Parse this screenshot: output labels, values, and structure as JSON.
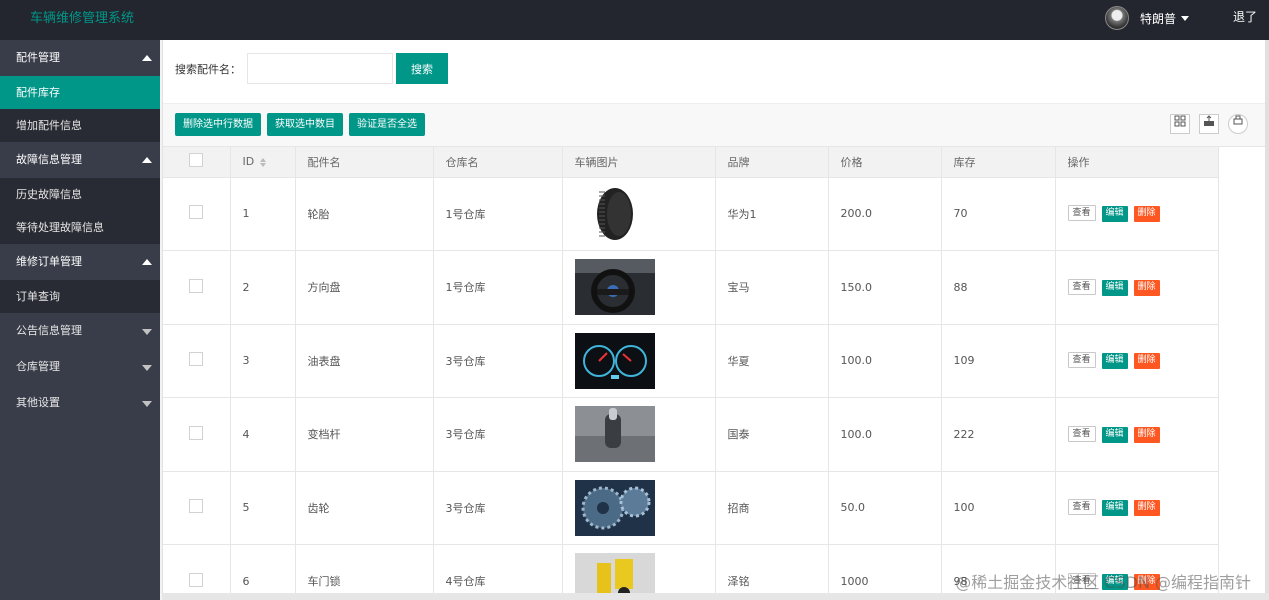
{
  "header": {
    "title": "车辆维修管理系统",
    "username": "特朗普",
    "logout": "退了"
  },
  "sidebar": {
    "groups": [
      {
        "label": "配件管理",
        "children": [
          "配件库存",
          "增加配件信息"
        ]
      },
      {
        "label": "故障信息管理",
        "children": [
          "历史故障信息",
          "等待处理故障信息"
        ]
      },
      {
        "label": "维修订单管理",
        "children": [
          "订单查询"
        ]
      },
      {
        "label": "公告信息管理",
        "children": []
      },
      {
        "label": "仓库管理",
        "children": []
      },
      {
        "label": "其他设置",
        "children": []
      }
    ]
  },
  "search": {
    "label": "搜索配件名：",
    "placeholder": "",
    "button": "搜索"
  },
  "toolbar": {
    "btn1": "删除选中行数据",
    "btn2": "获取选中数目",
    "btn3": "验证是否全选"
  },
  "table": {
    "headers": [
      "ID",
      "配件名",
      "仓库名",
      "车辆图片",
      "品牌",
      "价格",
      "库存",
      "操作"
    ],
    "rows": [
      {
        "id": "1",
        "name": "轮胎",
        "warehouse": "1号仓库",
        "image": "tire",
        "brand": "华为1",
        "price": "200.0",
        "stock": "70"
      },
      {
        "id": "2",
        "name": "方向盘",
        "warehouse": "1号仓库",
        "image": "steering-wheel",
        "brand": "宝马",
        "price": "150.0",
        "stock": "88"
      },
      {
        "id": "3",
        "name": "油表盘",
        "warehouse": "3号仓库",
        "image": "dashboard",
        "brand": "华夏",
        "price": "100.0",
        "stock": "109"
      },
      {
        "id": "4",
        "name": "变档杆",
        "warehouse": "3号仓库",
        "image": "gear-lever",
        "brand": "国泰",
        "price": "100.0",
        "stock": "222"
      },
      {
        "id": "5",
        "name": "齿轮",
        "warehouse": "3号仓库",
        "image": "gears",
        "brand": "招商",
        "price": "50.0",
        "stock": "100"
      },
      {
        "id": "6",
        "name": "车门锁",
        "warehouse": "4号仓库",
        "image": "door-lock",
        "brand": "泽铭",
        "price": "1000",
        "stock": "98"
      }
    ],
    "actions": {
      "view": "查看",
      "edit": "编辑",
      "delete": "删除"
    }
  },
  "watermark": "@稀土掘金技术社区 CSDN @编程指南针",
  "colors": {
    "accent": "#009688",
    "danger": "#ff5722",
    "sidebar": "#393d49",
    "header": "#23262e"
  }
}
